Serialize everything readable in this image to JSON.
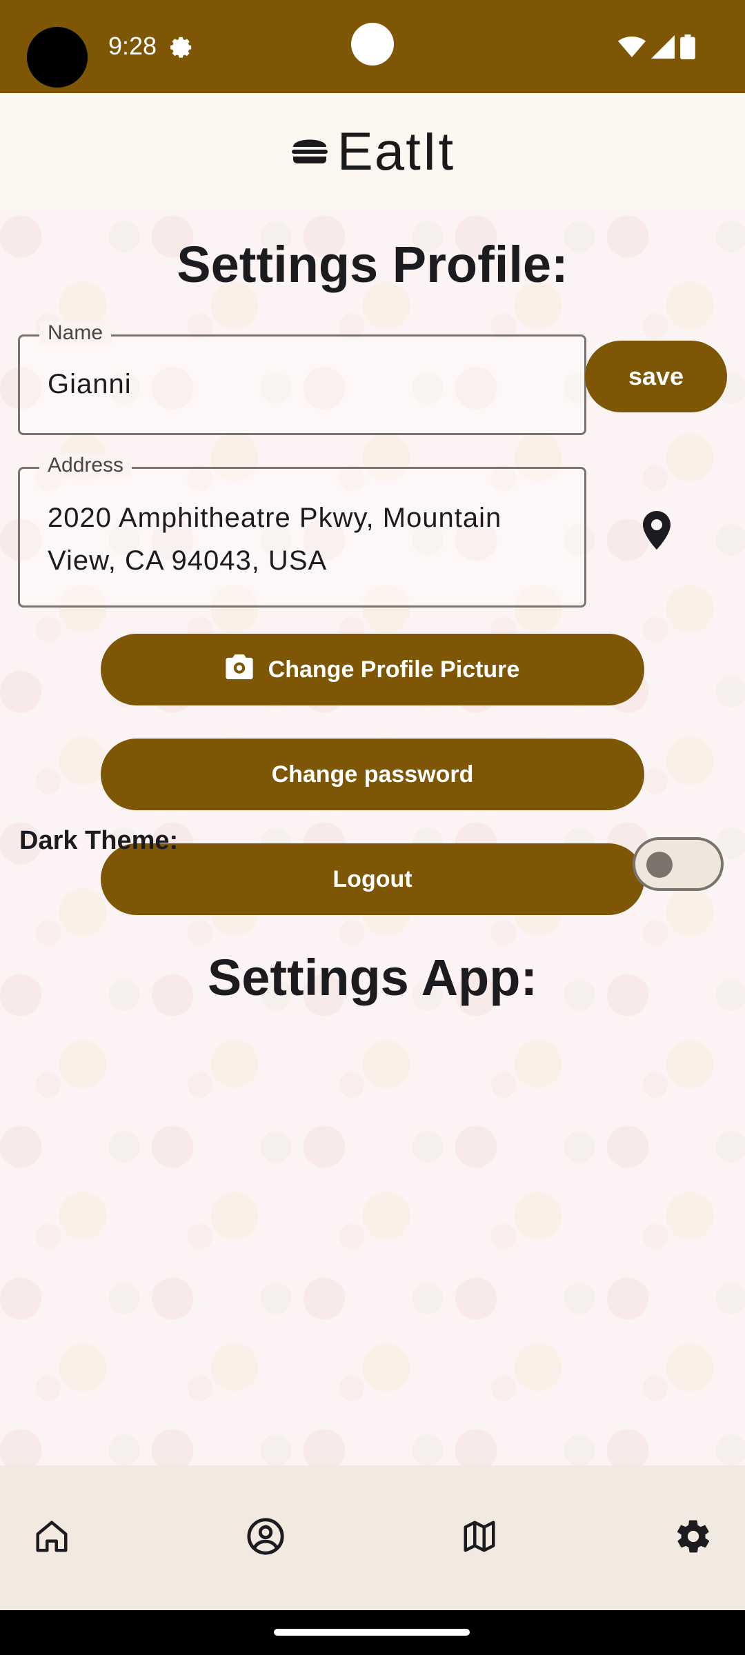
{
  "status_bar": {
    "time": "9:28",
    "icons": [
      "settings-gear-icon",
      "wifi-icon",
      "signal-icon",
      "battery-icon"
    ]
  },
  "header": {
    "app_title": "EatIt",
    "logo_icon": "burger-icon"
  },
  "profile": {
    "title": "Settings Profile:",
    "name_label": "Name",
    "name_value": "Gianni",
    "save_label": "save",
    "address_label": "Address",
    "address_line1": "2020 Amphitheatre Pkwy, Mountain",
    "address_line2": "View, CA 94043, USA",
    "change_picture_label": "Change Profile Picture",
    "change_password_label": "Change password",
    "logout_label": "Logout"
  },
  "app_settings": {
    "title": "Settings App:",
    "dark_theme_label": "Dark Theme:",
    "dark_theme_enabled": false
  },
  "bottom_nav": [
    "home-icon",
    "profile-icon",
    "map-icon",
    "settings-icon"
  ],
  "colors": {
    "primary": "#7d5706",
    "header_bg": "#fdf7f2",
    "nav_bg": "#f2eae0"
  }
}
